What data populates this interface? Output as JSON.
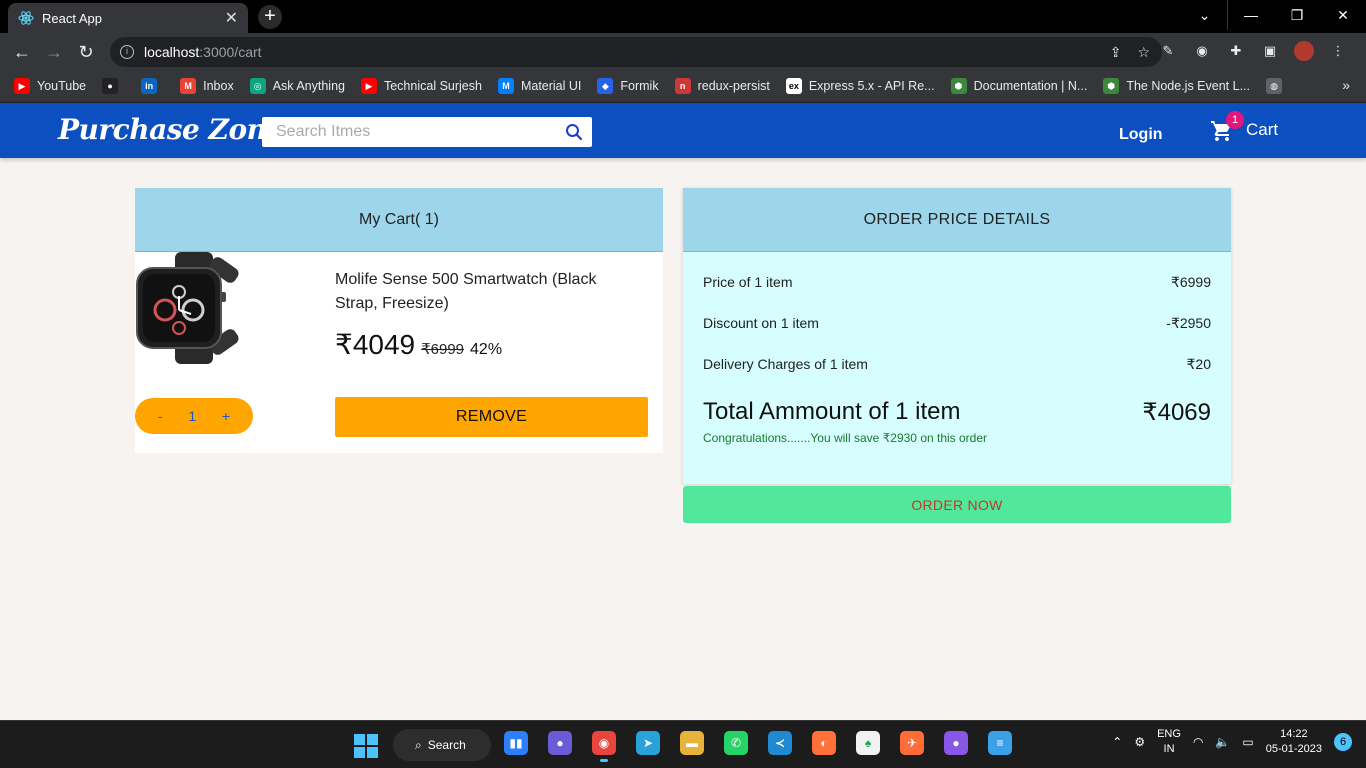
{
  "browser": {
    "tab_title": "React App",
    "tab_close": "✕",
    "new_tab": "+",
    "url_host": "localhost",
    "url_path": ":3000/cart",
    "bookmarks": [
      {
        "label": "YouTube",
        "icon": "youtube-icon",
        "color": "#ff0000",
        "glyph": "▶"
      },
      {
        "label": "",
        "icon": "github-icon",
        "color": "#222222",
        "glyph": "●"
      },
      {
        "label": "",
        "icon": "linkedin-icon",
        "color": "#0a66c2",
        "glyph": "in"
      },
      {
        "label": "Inbox",
        "icon": "gmail-icon",
        "color": "#ea4335",
        "glyph": "M"
      },
      {
        "label": "Ask Anything",
        "icon": "chatgpt-icon",
        "color": "#10a37f",
        "glyph": "◎"
      },
      {
        "label": "Technical Surjesh",
        "icon": "youtube-icon",
        "color": "#ff0000",
        "glyph": "▶"
      },
      {
        "label": "Material UI",
        "icon": "mui-icon",
        "color": "#007fff",
        "glyph": "M"
      },
      {
        "label": "Formik",
        "icon": "formik-icon",
        "color": "#2563eb",
        "glyph": "◆"
      },
      {
        "label": "redux-persist",
        "icon": "npm-icon",
        "color": "#cb3837",
        "glyph": "n"
      },
      {
        "label": "Express 5.x - API Re...",
        "icon": "express-icon",
        "color": "#ffffff",
        "glyph": "ex"
      },
      {
        "label": "Documentation | N...",
        "icon": "nodejs-icon",
        "color": "#3c873a",
        "glyph": "⬢"
      },
      {
        "label": "The Node.js Event L...",
        "icon": "nodejs-icon",
        "color": "#3c873a",
        "glyph": "⬢"
      },
      {
        "label": "",
        "icon": "globe-icon",
        "color": "#5f6368",
        "glyph": "◍"
      }
    ],
    "bookmarks_more": "»"
  },
  "header": {
    "logo": "Purchase Zone",
    "search_placeholder": "Search Itmes",
    "login": "Login",
    "cart_label": "Cart",
    "cart_count": "1",
    "brand_color": "#0b4fc0"
  },
  "cart": {
    "title": "My Cart( 1)",
    "item": {
      "name": "Molife Sense 500 Smartwatch (Black Strap, Freesize)",
      "price": "₹4049",
      "original_price": "₹6999",
      "discount": "42%",
      "qty_minus": "-",
      "quantity": "1",
      "qty_plus": "+"
    },
    "remove_label": "REMOVE"
  },
  "price_details": {
    "title": "ORDER PRICE DETAILS",
    "lines": [
      {
        "label": "Price of 1 item",
        "value": "₹6999"
      },
      {
        "label": "Discount on 1 item",
        "value": "-₹2950"
      },
      {
        "label": "Delivery Charges of 1 item",
        "value": "₹20"
      }
    ],
    "total_label": "Total Ammount of 1 item",
    "total_value": "₹4069",
    "savings": "Congratulations.......You will save ₹2930 on this order",
    "order_label": "ORDER NOW"
  },
  "taskbar": {
    "search_label": "Search",
    "lang_line1": "ENG",
    "lang_line2": "IN",
    "time": "14:22",
    "date": "05-01-2023",
    "notifications": "6"
  }
}
